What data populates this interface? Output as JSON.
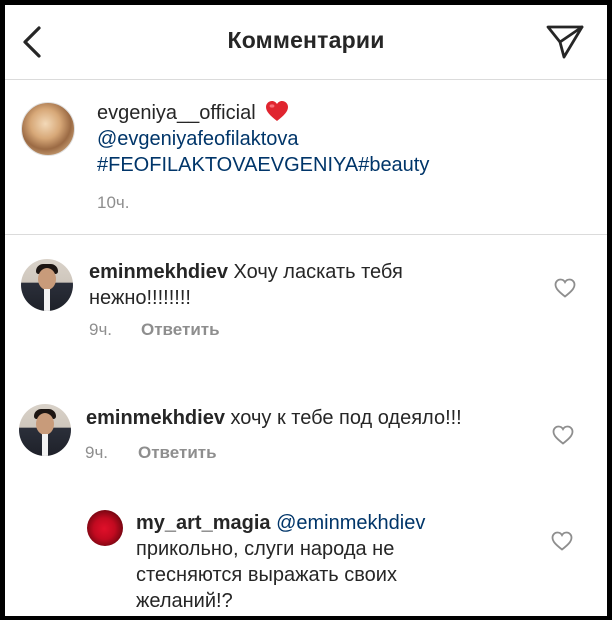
{
  "header": {
    "title": "Комментарии"
  },
  "caption": {
    "username": "evgeniya__official",
    "mention": "@evgeniyafeofilaktova",
    "hashtags": "#FEOFILAKTOVAEVGENIYA#beauty",
    "time": "10ч."
  },
  "comments": [
    {
      "username": "eminmekhdiev",
      "text_line1": "Хочу ласкать тебя",
      "text_line2": "нежно!!!!!!!!",
      "time": "9ч.",
      "reply_label": "Ответить"
    },
    {
      "username": "eminmekhdiev",
      "text_line1": "хочу к тебе под одеяло!!!",
      "time": "9ч.",
      "reply_label": "Ответить"
    }
  ],
  "reply": {
    "username": "my_art_magia",
    "mention": "@eminmekhdiev",
    "text_line1": "прикольно, слуги народа не",
    "text_line2": "стесняются выражать своих",
    "text_line3": "желаний!?"
  },
  "colors": {
    "text": "#262626",
    "secondary": "#8e8e8e",
    "link": "#003569",
    "divider": "#dbdbdb",
    "heart": "#ed4956"
  },
  "icons": {
    "back": "chevron-left-icon",
    "send": "paper-plane-icon",
    "like": "heart-outline-icon",
    "emoji": "red-heart-emoji-icon"
  }
}
